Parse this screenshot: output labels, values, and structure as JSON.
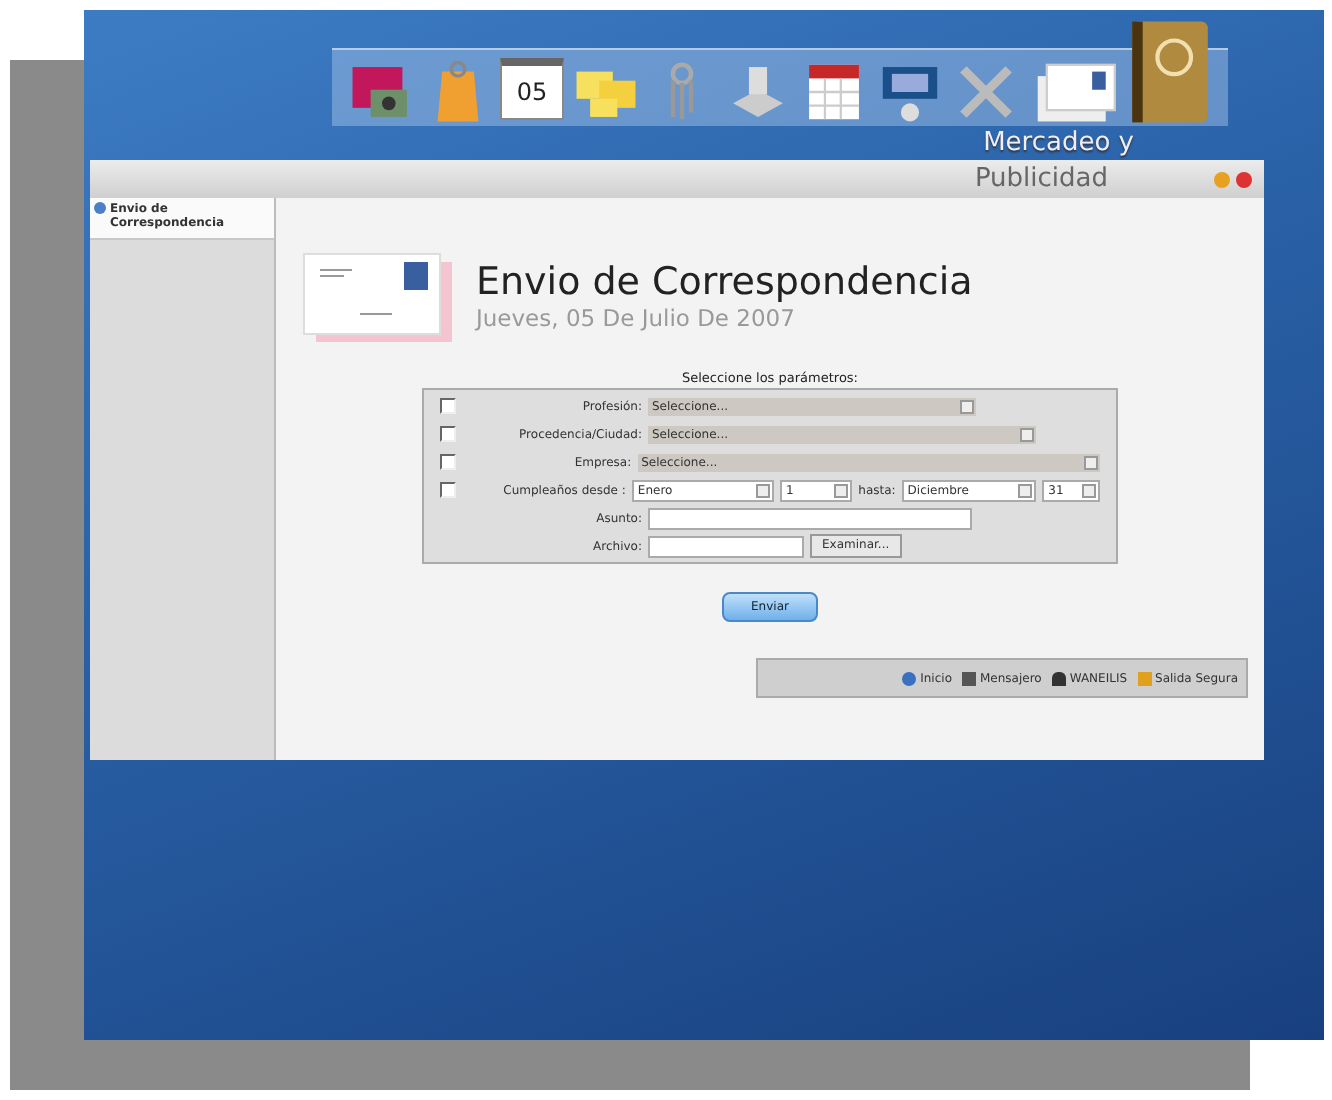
{
  "dock": {
    "calendar_day": "05"
  },
  "window": {
    "title_line1": "Mercadeo y",
    "title_line2": "Publicidad"
  },
  "sidebar": {
    "items": [
      {
        "label": "Envio de Correspondencia",
        "selected": true
      }
    ]
  },
  "header": {
    "title": "Envio de Correspondencia",
    "date": "Jueves, 05 De Julio De 2007"
  },
  "form": {
    "caption": "Seleccione los parámetros:",
    "rows": [
      {
        "kind": "select",
        "checked": false,
        "label": "Profesión:",
        "value": "Seleccione..."
      },
      {
        "kind": "select",
        "checked": false,
        "label": "Procedencia/Ciudad:",
        "value": "Seleccione..."
      },
      {
        "kind": "select",
        "checked": false,
        "label": "Empresa:",
        "value": "Seleccione..."
      },
      {
        "kind": "range",
        "checked": false,
        "label": "Cumpleaños desde :",
        "from_month": "Enero",
        "from_day": "1",
        "to_label": "hasta:",
        "to_month": "Diciembre",
        "to_day": "31"
      },
      {
        "kind": "text",
        "label": "Asunto:"
      },
      {
        "kind": "file",
        "label": "Archivo:",
        "button": "Examinar..."
      }
    ],
    "submit": "Enviar"
  },
  "footer": {
    "links": [
      {
        "kind": "home",
        "label": "Inicio"
      },
      {
        "kind": "mail",
        "label": "Mensajero"
      },
      {
        "kind": "user",
        "label": "WANEILIS"
      },
      {
        "kind": "exit",
        "label": "Salida Segura"
      }
    ]
  }
}
